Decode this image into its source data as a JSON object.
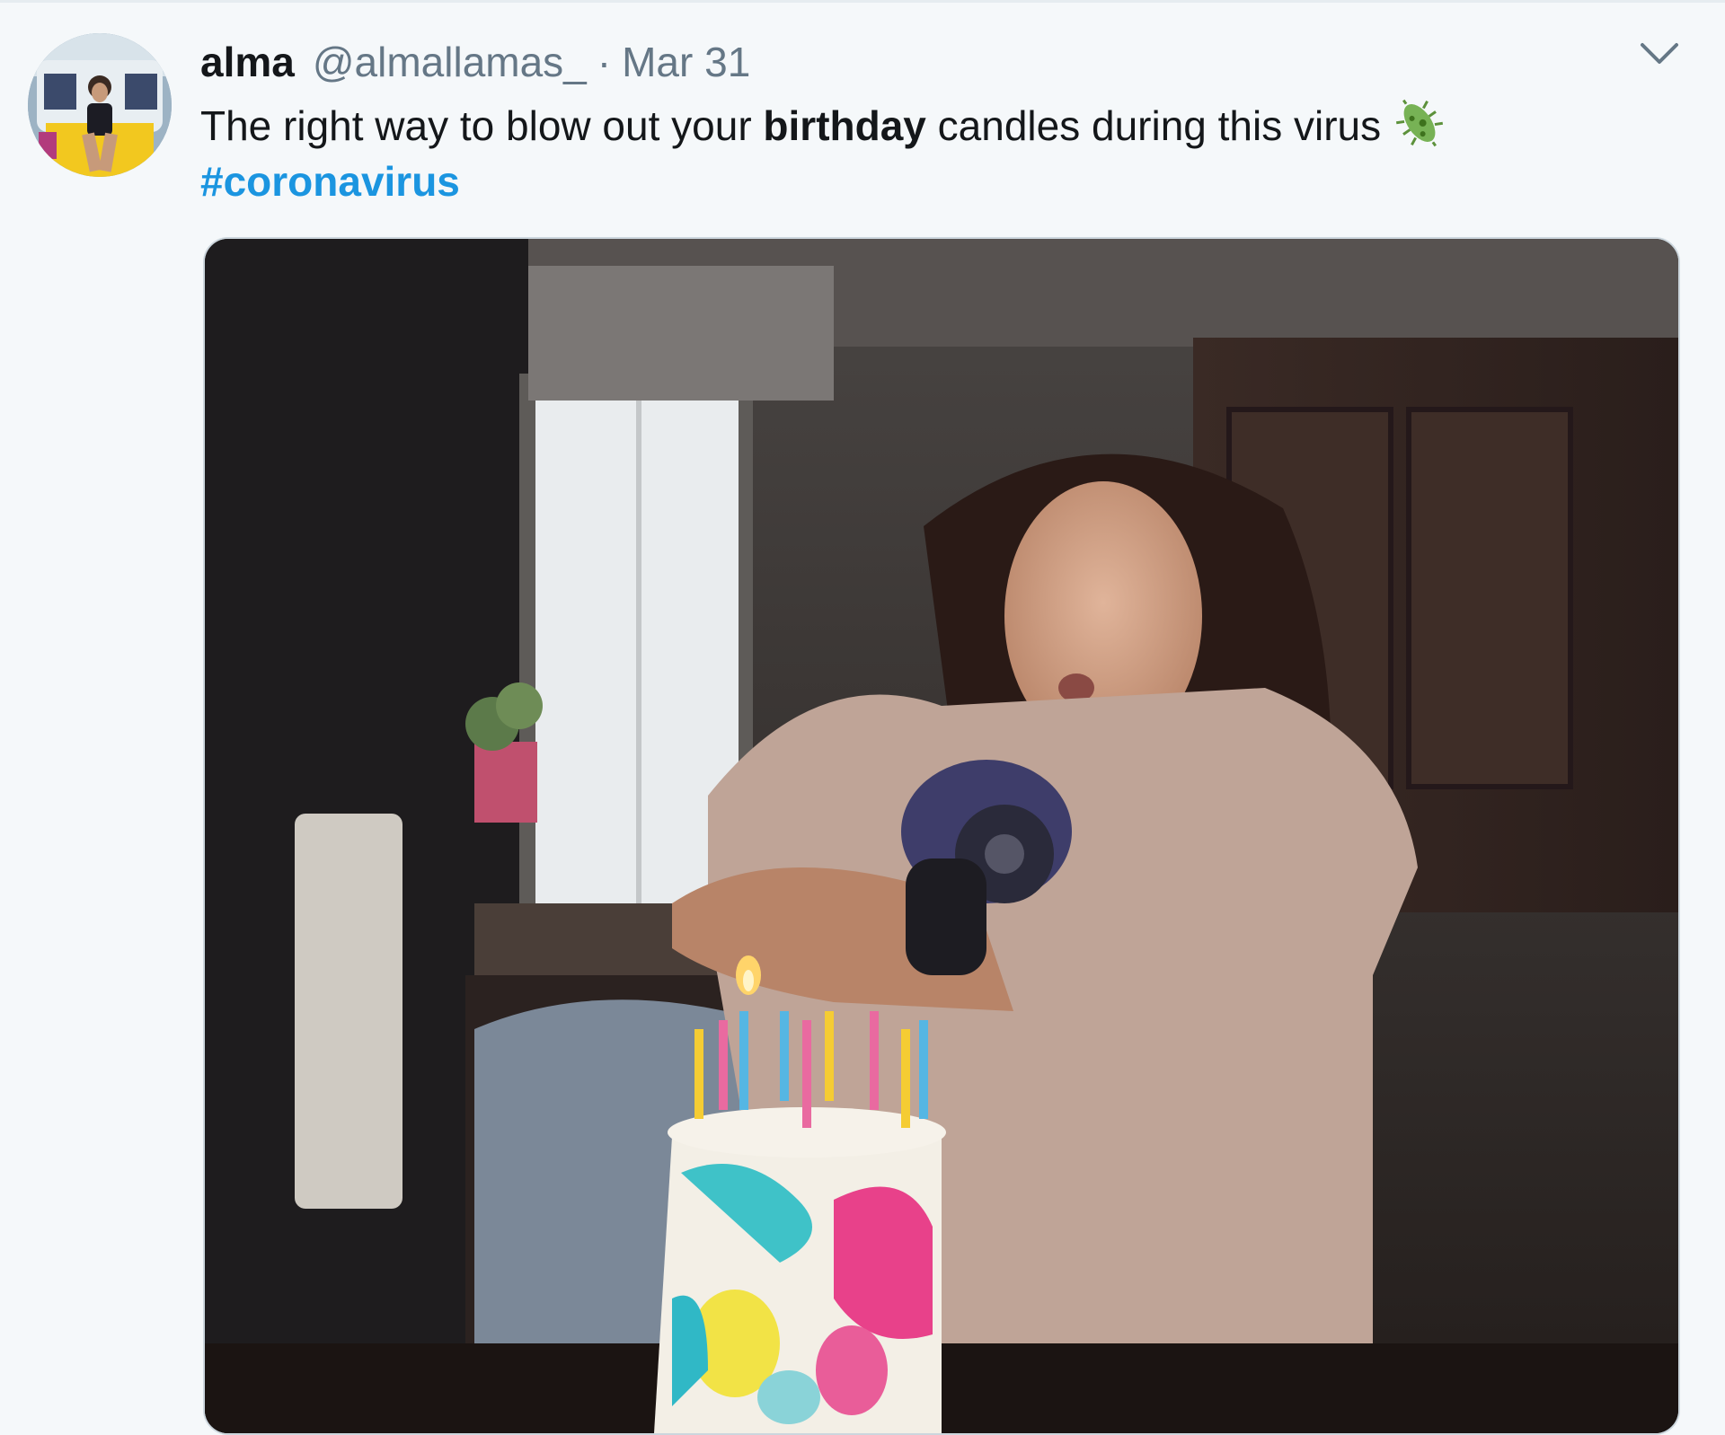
{
  "tweet": {
    "author": {
      "display_name": "alma",
      "handle": "@almallamas_",
      "separator": "·",
      "date": "Mar 31",
      "avatar_icon": "profile-photo"
    },
    "text": {
      "part1": "The right way to blow out your ",
      "bold": "birthday",
      "part2": " candles during this virus",
      "emoji": "microbe-emoji",
      "hashtag": "#coronavirus"
    },
    "menu_icon": "chevron-down-icon",
    "media": {
      "type": "video-thumbnail"
    },
    "colors": {
      "background": "#f5f8fa",
      "text": "#14171a",
      "secondary": "#657786",
      "link": "#1b95e0",
      "border": "#ccd6dd",
      "microbe": "#77b255"
    }
  }
}
